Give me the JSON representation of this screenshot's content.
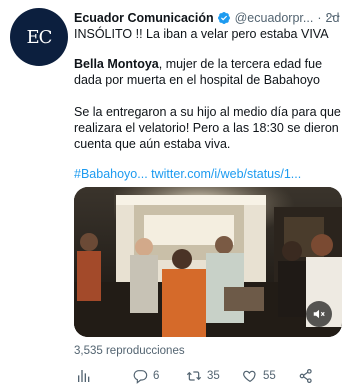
{
  "account": {
    "avatar_text": "EC",
    "name": "Ecuador Comunicación",
    "handle": "@ecuadorpr...",
    "separator": "·",
    "time": "2d",
    "more": "···"
  },
  "tweet": {
    "line1": "INSÓLITO !! La iban a velar pero estaba VIVA",
    "para2_bold": "Bella Montoya",
    "para2_rest": ", mujer de la tercera edad fue dada por muerta en el hospital de Babahoyo",
    "para3": "Se la entregaron a su hijo al medio día para que realizara el velatorio! Pero a las 18:30 se dieron cuenta que aún estaba viva.",
    "hashtag": "#Babahoyo...",
    "link": "twitter.com/i/web/status/1..."
  },
  "views": "3,535 reproducciones",
  "actions": {
    "replies": "6",
    "retweets": "35",
    "likes": "55"
  },
  "colors": {
    "link": "#1d9bf0",
    "verified": "#1d9bf0",
    "muted": "#536471"
  },
  "icons": {
    "verified": "verified-badge-icon",
    "analytics": "analytics-icon",
    "reply": "reply-icon",
    "retweet": "retweet-icon",
    "like": "heart-icon",
    "share": "share-icon",
    "sound": "speaker-muted-icon"
  }
}
